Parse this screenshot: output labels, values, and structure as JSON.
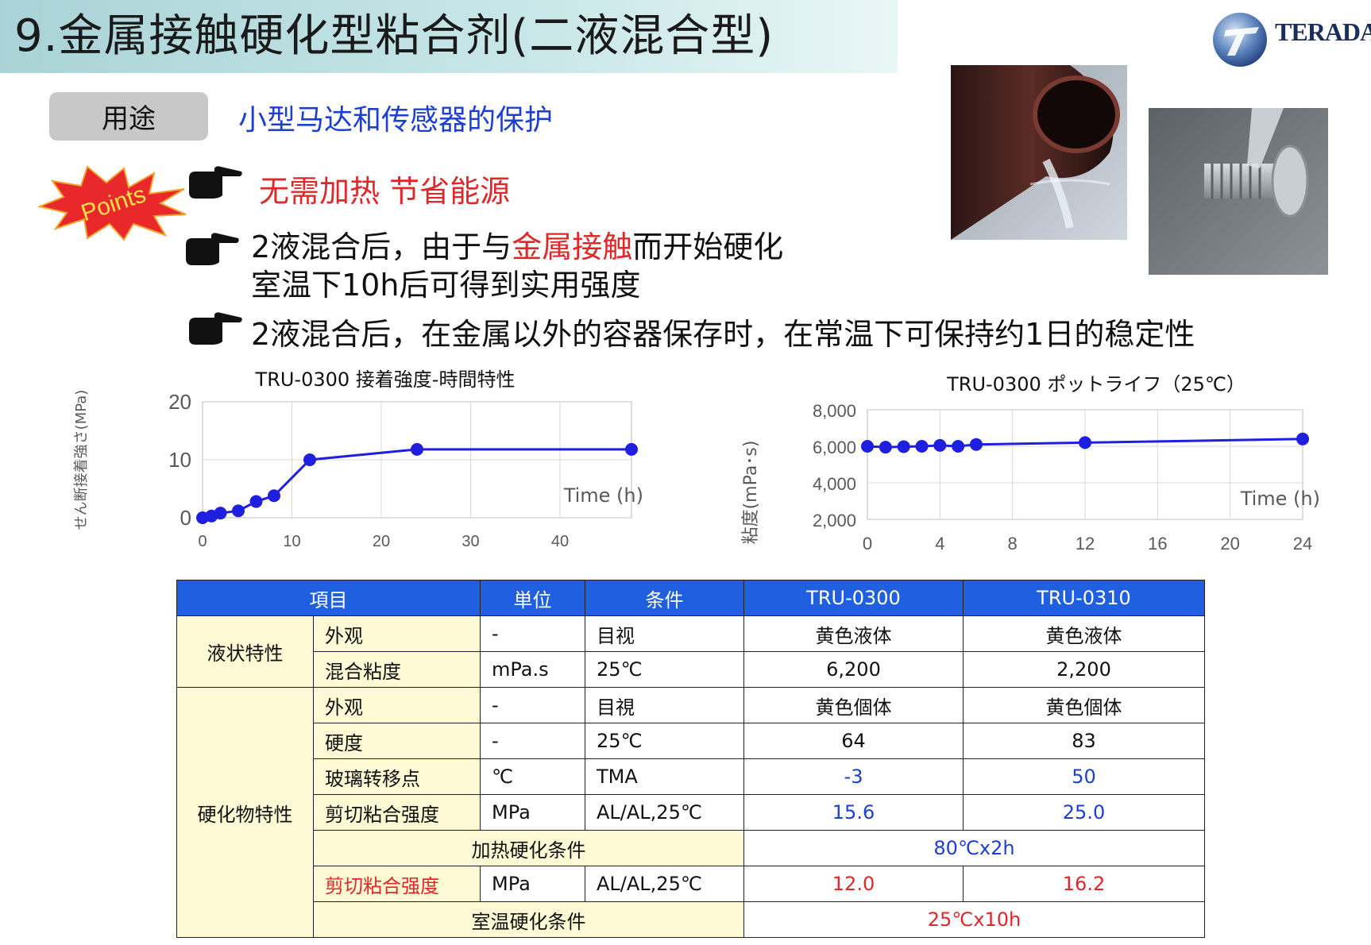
{
  "title": "9.金属接触硬化型粘合剂(二液混合型)",
  "logo": {
    "text": "TERADA"
  },
  "usage": {
    "label": "用途",
    "text": "小型马达和传感器的保护"
  },
  "points": {
    "badge": "Points",
    "items": [
      {
        "parts": [
          "无需加热  节省能源"
        ]
      },
      {
        "line1_pre": "2液混合后，由于与",
        "line1_red": "金属接触",
        "line1_post": "而开始硬化",
        "line2": "室温下10h后可得到实用强度"
      },
      {
        "line1": "2液混合后，在金属以外的容器保存时，在常温下可保持约1日的稳定性"
      }
    ]
  },
  "chart_data": [
    {
      "type": "line",
      "title": "TRU-0300 接着強度-時間特性",
      "ylabel": "せん断接着強さ(MPa)",
      "xlabel": "Time (h)",
      "xlim": [
        0,
        48
      ],
      "ylim": [
        0,
        20
      ],
      "xticks": [
        0,
        10,
        20,
        30,
        40
      ],
      "yticks": [
        0,
        10,
        20
      ],
      "grid": true,
      "series": [
        {
          "x": [
            0,
            1,
            2,
            4,
            6,
            8,
            12,
            24,
            48
          ],
          "y": [
            0,
            0.3,
            0.8,
            1.2,
            2.8,
            3.8,
            10,
            11.8,
            11.8
          ]
        }
      ]
    },
    {
      "type": "line",
      "title": "TRU-0300 ポットライフ（25℃）",
      "ylabel": "粘度(mPa･s)",
      "xlabel": "Time (h)",
      "xlim": [
        0,
        24
      ],
      "ylim": [
        2000,
        8000
      ],
      "xticks": [
        0,
        4,
        8,
        12,
        16,
        20,
        24
      ],
      "yticks": [
        2000,
        4000,
        6000,
        8000
      ],
      "ytick_labels": [
        "2,000",
        "4,000",
        "6,000",
        "8,000"
      ],
      "grid": true,
      "series": [
        {
          "x": [
            0,
            1,
            2,
            3,
            4,
            5,
            6,
            12,
            24
          ],
          "y": [
            6000,
            5950,
            5980,
            6000,
            6050,
            6000,
            6100,
            6200,
            6400
          ]
        }
      ]
    }
  ],
  "table": {
    "headers": [
      "項目",
      "単位",
      "条件",
      "TRU-0300",
      "TRU-0310"
    ],
    "group1": "液状特性",
    "group2": "硬化物特性",
    "rows": {
      "r1": [
        "外观",
        "-",
        "目视",
        "黄色液体",
        "黄色液体"
      ],
      "r2": [
        "混合粘度",
        "mPa.s",
        "25℃",
        "6,200",
        "2,200"
      ],
      "r3": [
        "外观",
        "-",
        "目視",
        "黄色個体",
        "黄色個体"
      ],
      "r4": [
        "硬度",
        "-",
        "25℃",
        "64",
        "83"
      ],
      "r5": [
        "玻璃转移点",
        "℃",
        "TMA",
        "-3",
        "50"
      ],
      "r6": [
        "剪切粘合强度",
        "MPa",
        "AL/AL,25℃",
        "15.6",
        "25.0"
      ],
      "r7": [
        "加热硬化条件",
        "80℃x2h"
      ],
      "r8": [
        "剪切粘合强度",
        "MPa",
        "AL/AL,25℃",
        "12.0",
        "16.2"
      ],
      "r9": [
        "室温硬化条件",
        "25℃x10h"
      ]
    }
  },
  "colors": {
    "accent_blue": "#1c3fd0",
    "accent_red": "#e0282a",
    "header_blue": "#2060e0",
    "row_yellow": "#fcf9d4"
  }
}
